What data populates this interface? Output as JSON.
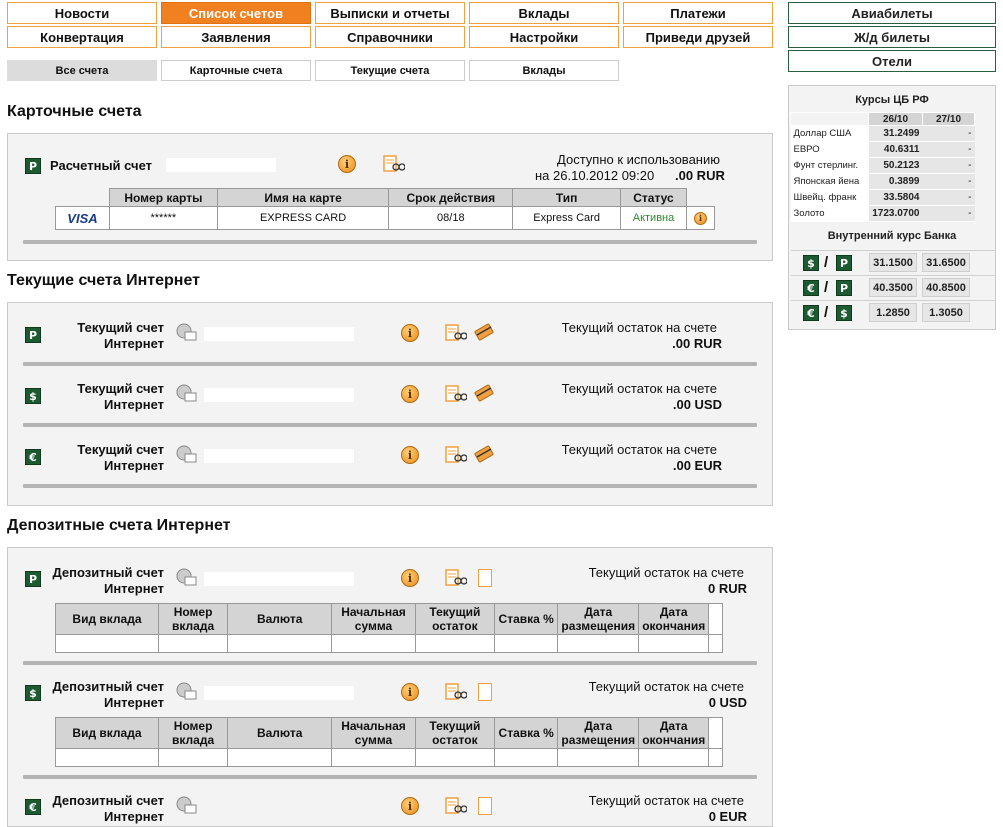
{
  "nav": {
    "row1": [
      "Новости",
      "Список счетов",
      "Выписки и отчеты",
      "Вклады",
      "Платежи"
    ],
    "row2": [
      "Конвертация",
      "Заявления",
      "Справочники",
      "Настройки",
      "Приведи друзей"
    ],
    "side": [
      "Авиабилеты",
      "Ж/д билеты",
      "Отели"
    ]
  },
  "subtabs": [
    "Все счета",
    "Карточные счета",
    "Текущие счета",
    "Вклады"
  ],
  "card_section": {
    "title": "Карточные счета",
    "account_name": "Расчетный счет",
    "avail_label": "Доступно к использованию",
    "avail_date": "на 26.10.2012 09:20",
    "avail_value": ".00 RUR",
    "headers": [
      "Номер карты",
      "Имя на карте",
      "Срок действия",
      "Тип",
      "Статус"
    ],
    "row": {
      "brand": "VISA",
      "number": "******",
      "name": "EXPRESS CARD",
      "expiry": "08/18",
      "type": "Express Card",
      "status": "Активна"
    }
  },
  "current_section": {
    "title": "Текущие счета Интернет",
    "accounts": [
      {
        "name1": "Текущий счет",
        "name2": "Интернет",
        "label": "Текущий остаток на счете",
        "value": ".00 RUR",
        "currency_icon": "Р"
      },
      {
        "name1": "Текущий счет",
        "name2": "Интернет",
        "label": "Текущий остаток на счете",
        "value": ".00 USD",
        "currency_icon": "$"
      },
      {
        "name1": "Текущий счет",
        "name2": "Интернет",
        "label": "Текущий остаток на счете",
        "value": ".00 EUR",
        "currency_icon": "€"
      }
    ]
  },
  "deposit_section": {
    "title": "Депозитные счета Интернет",
    "headers": [
      "Вид вклада",
      "Номер вклада",
      "Валюта",
      "Начальная сумма",
      "Текущий остаток",
      "Ставка %",
      "Дата размещения",
      "Дата окончания"
    ],
    "accounts": [
      {
        "name1": "Депозитный счет",
        "name2": "Интернет",
        "label": "Текущий остаток на счете",
        "value": "0 RUR",
        "currency_icon": "Р"
      },
      {
        "name1": "Депозитный счет",
        "name2": "Интернет",
        "label": "Текущий остаток на счете",
        "value": "0 USD",
        "currency_icon": "$"
      },
      {
        "name1": "Депозитный счет",
        "name2": "Интернет",
        "label": "Текущий остаток на счете",
        "value": "0 EUR",
        "currency_icon": "€"
      }
    ]
  },
  "rates": {
    "title": "Курсы ЦБ РФ",
    "dates": [
      "26/10",
      "27/10"
    ],
    "rows": [
      {
        "name": "Доллар США",
        "v1": "31.2499",
        "v2": "-"
      },
      {
        "name": "ЕВРО",
        "v1": "40.6311",
        "v2": "-"
      },
      {
        "name": "Фунт стерлинг.",
        "v1": "50.2123",
        "v2": "-"
      },
      {
        "name": "Японская йена",
        "v1": "0.3899",
        "v2": "-"
      },
      {
        "name": "Швейц. франк",
        "v1": "33.5804",
        "v2": "-"
      },
      {
        "name": "Золото",
        "v1": "1723.0700",
        "v2": "-"
      }
    ],
    "bank_title": "Внутренний курс Банка",
    "bank_rows": [
      {
        "from": "$",
        "to": "Р",
        "buy": "31.1500",
        "sell": "31.6500"
      },
      {
        "from": "€",
        "to": "Р",
        "buy": "40.3500",
        "sell": "40.8500"
      },
      {
        "from": "€",
        "to": "$",
        "buy": "1.2850",
        "sell": "1.3050"
      }
    ]
  },
  "colors": {
    "accent": "#f08020",
    "nav_border": "#f0a040",
    "currency_green": "#1d5a32",
    "status_green": "#2a8a2a"
  }
}
